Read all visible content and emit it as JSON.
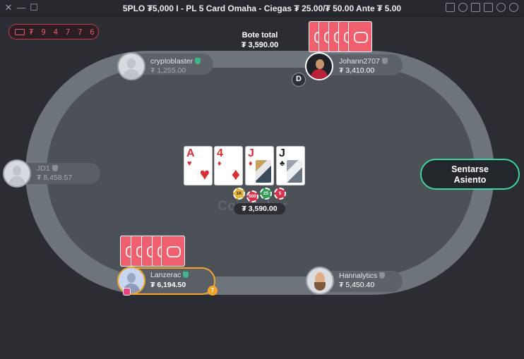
{
  "window": {
    "title": "5PLO ₮5,000 I - PL 5 Card Omaha - Ciegas ₮ 25.00/₮ 50.00 Ante ₮ 5.00",
    "close_icon": "close-icon",
    "toolbar_icons": [
      "layout-icon",
      "history-icon",
      "add-table-icon",
      "chat-icon",
      "link-icon",
      "settings-icon"
    ]
  },
  "balance": {
    "value": "₮ 9 4 7 7 6",
    "icon": "wallet-icon"
  },
  "pot": {
    "label": "Bote total",
    "total": "₮ 3,590.00",
    "center": "₮ 3,590.00",
    "logo": "CoinPoker"
  },
  "board": [
    {
      "rank": "A",
      "suit": "♥",
      "color": "red"
    },
    {
      "rank": "4",
      "suit": "♦",
      "color": "red"
    },
    {
      "rank": "J",
      "suit": "♦",
      "color": "red"
    },
    {
      "rank": "J",
      "suit": "♣",
      "color": "black"
    }
  ],
  "chips": [
    "1K",
    "500",
    "25",
    "5"
  ],
  "players": {
    "cryptoblaster": {
      "name": "cryptoblaster",
      "stack": "₮ 1,255.00"
    },
    "johann": {
      "name": "Johann2707",
      "stack": "₮ 3,410.00",
      "dealer": "D"
    },
    "jd1": {
      "name": "JD1",
      "stack": "₮ 8,458.57"
    },
    "lanzerac": {
      "name": "Lanzerac",
      "stack": "₮ 6,194.50",
      "timer": "7"
    },
    "hannalytics": {
      "name": "Hannalytics",
      "stack": "₮ 5,450.40"
    }
  },
  "sit_button": {
    "line1": "Sentarse",
    "line2": "Asiento"
  },
  "colors": {
    "accent_green": "#3ed69c",
    "card_back": "#ef5f6d",
    "active_seat": "#f2a42c"
  }
}
